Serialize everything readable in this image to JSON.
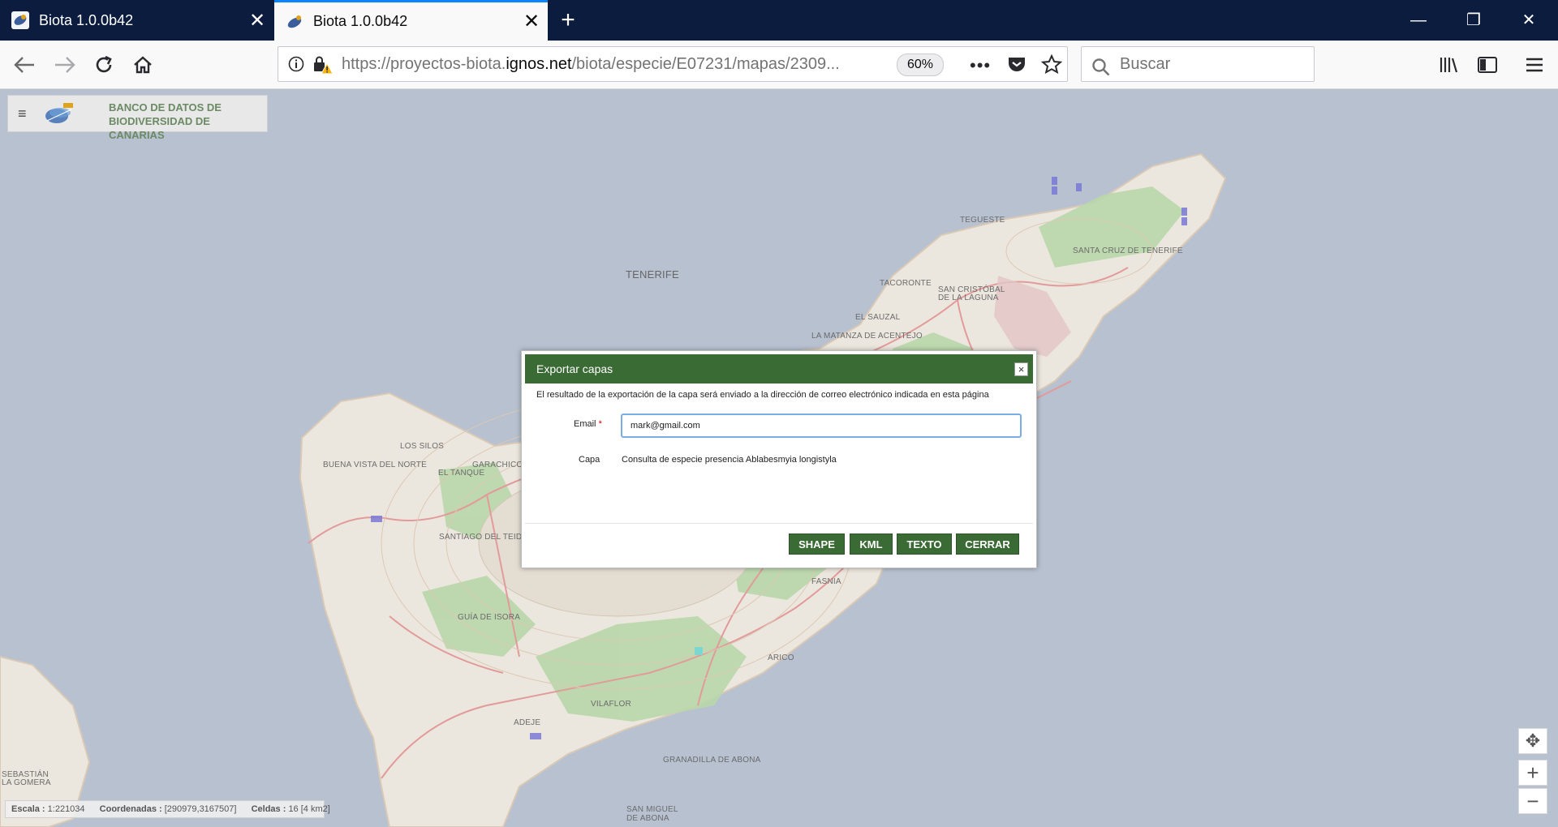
{
  "browser": {
    "tabs": [
      {
        "title": "Biota 1.0.0b42"
      },
      {
        "title": "Biota 1.0.0b42"
      }
    ],
    "url": {
      "prefix": "https://proyectos-biota.",
      "domain": "ignos.net",
      "path": "/biota/especie/E07231/mapas/2309..."
    },
    "zoom": "60%",
    "search_placeholder": "Buscar",
    "accent": "#0a84ff"
  },
  "app": {
    "brand_line1": "BANCO DE DATOS DE",
    "brand_line2": "BIODIVERSIDAD DE CANARIAS",
    "status": {
      "escala_label": "Escala :",
      "escala_value": "1:221034",
      "coord_label": "Coordenadas :",
      "coord_value": "[290979,3167507]",
      "celdas_label": "Celdas :",
      "celdas_value": "16 [4 km2]"
    }
  },
  "map": {
    "labels": {
      "tenerife": "TENERIFE",
      "tegueste": "TEGUESTE",
      "santa_cruz": "SANTA CRUZ DE TENERIFE",
      "tacoronte": "TACORONTE",
      "san_cristobal_1": "SAN CRISTÓBAL",
      "san_cristobal_2": "DE LA LAGUNA",
      "el_sauzal": "EL SAUZAL",
      "la_matanza": "LA MATANZA DE ACENTEJO",
      "los_silos": "LOS SILOS",
      "buenavista": "BUENA VISTA DEL NORTE",
      "garachico": "GARACHICO",
      "el_tanque": "EL TANQUE",
      "santiago": "SANTIAGO DEL TEIDE",
      "guia": "GUÍA DE ISORA",
      "fasnia": "FASNIA",
      "arico": "ARICO",
      "vilaflor": "VILAFLOR",
      "adeje": "ADEJE",
      "granadilla": "GRANADILLA DE ABONA",
      "san_miguel_1": "SAN MIGUEL",
      "san_miguel_2": "DE ABONA",
      "san_sebastian_1": "SEBASTIÁN",
      "san_sebastian_2": "LA GOMERA"
    },
    "colors": {
      "sea": "#b7c1d0",
      "land": "#ebe6dc",
      "veg": "#a9cf9a",
      "roads": "#e28a8a",
      "cells": "#7b79d6"
    }
  },
  "dialog": {
    "title": "Exportar capas",
    "close_glyph": "×",
    "message": "El resultado de la exportación de la capa será enviado a la dirección de correo electrónico indicada en esta página",
    "email_label": "Email",
    "required_mark": "*",
    "email_value": "mark@gmail.com",
    "capa_label": "Capa",
    "capa_value": "Consulta de especie presencia Ablabesmyia longistyla",
    "buttons": {
      "shape": "SHAPE",
      "kml": "KML",
      "texto": "TEXTO",
      "cerrar": "CERRAR"
    },
    "accent": "#3b6b35"
  }
}
